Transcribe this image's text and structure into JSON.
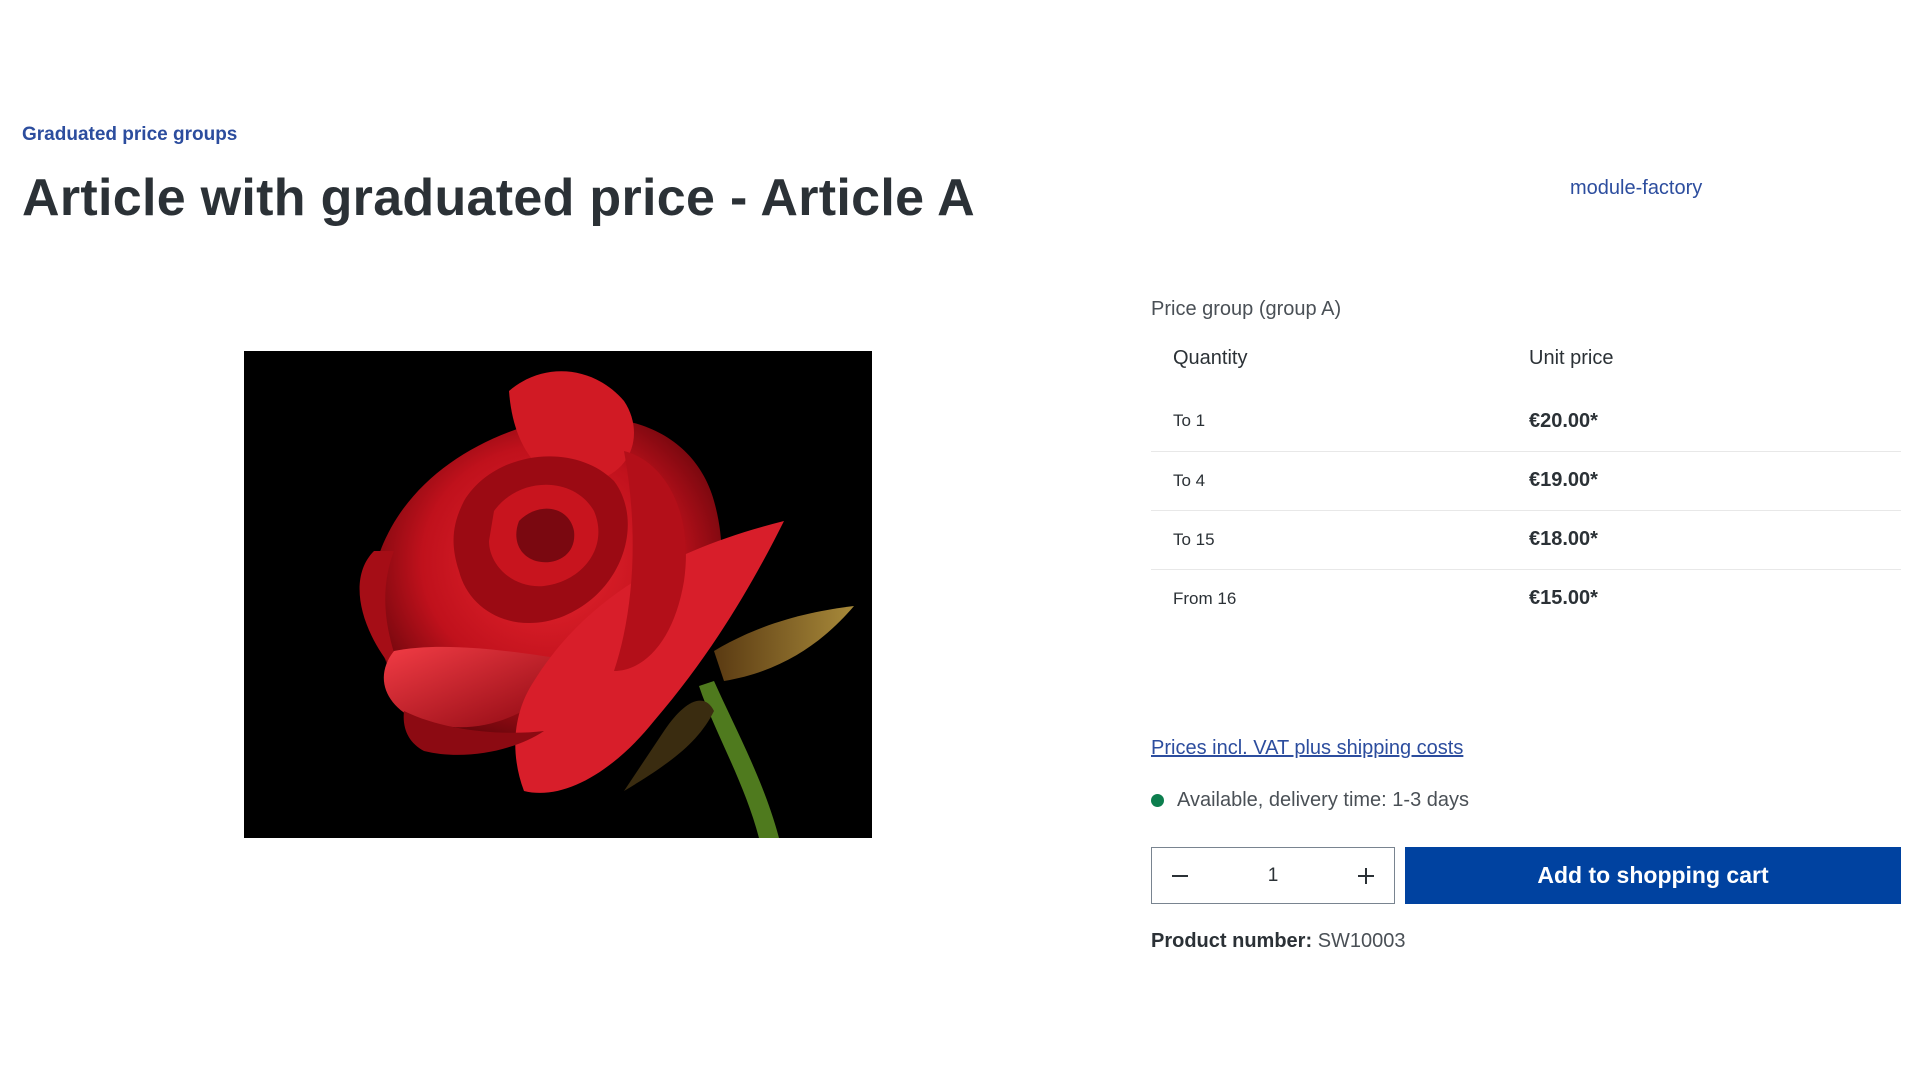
{
  "breadcrumb": {
    "category": "Graduated price groups"
  },
  "product": {
    "title": "Article with graduated price - Article A",
    "manufacturer": "module-factory",
    "image_alt": "red rose"
  },
  "price_table": {
    "group_label": "Price group (group A)",
    "headers": {
      "quantity": "Quantity",
      "unit_price": "Unit price"
    },
    "rows": [
      {
        "quantity": "To 1",
        "price": "€20.00*"
      },
      {
        "quantity": "To 4",
        "price": "€19.00*"
      },
      {
        "quantity": "To 15",
        "price": "€18.00*"
      },
      {
        "quantity": "From 16",
        "price": "€15.00*"
      }
    ]
  },
  "vat_link": "Prices incl. VAT plus shipping costs",
  "delivery": {
    "text": "Available, delivery time: 1-3 days",
    "status_color": "#0c7e4e"
  },
  "quantity": {
    "value": "1",
    "minus_icon": "minus-icon",
    "plus_icon": "plus-icon"
  },
  "cart": {
    "button_label": "Add to shopping cart",
    "button_color": "#0042a0"
  },
  "product_number": {
    "label": "Product number:",
    "value": "SW10003"
  },
  "colors": {
    "accent": "#2c4d9e",
    "text": "#2b3136"
  }
}
